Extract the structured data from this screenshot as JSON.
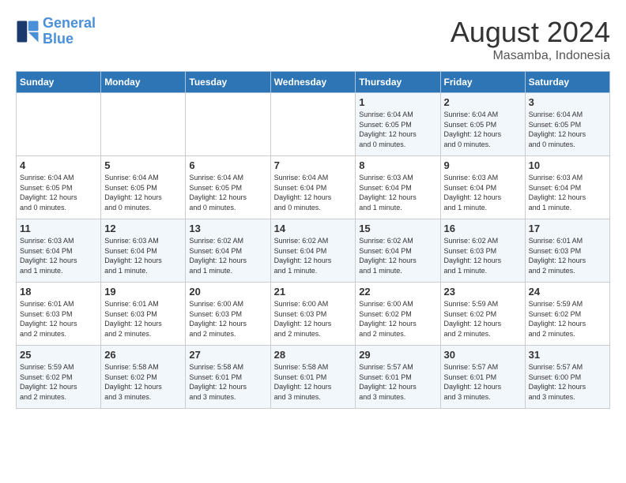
{
  "header": {
    "logo_line1": "General",
    "logo_line2": "Blue",
    "month_year": "August 2024",
    "location": "Masamba, Indonesia"
  },
  "days_of_week": [
    "Sunday",
    "Monday",
    "Tuesday",
    "Wednesday",
    "Thursday",
    "Friday",
    "Saturday"
  ],
  "weeks": [
    [
      {
        "day": "",
        "info": ""
      },
      {
        "day": "",
        "info": ""
      },
      {
        "day": "",
        "info": ""
      },
      {
        "day": "",
        "info": ""
      },
      {
        "day": "1",
        "info": "Sunrise: 6:04 AM\nSunset: 6:05 PM\nDaylight: 12 hours\nand 0 minutes."
      },
      {
        "day": "2",
        "info": "Sunrise: 6:04 AM\nSunset: 6:05 PM\nDaylight: 12 hours\nand 0 minutes."
      },
      {
        "day": "3",
        "info": "Sunrise: 6:04 AM\nSunset: 6:05 PM\nDaylight: 12 hours\nand 0 minutes."
      }
    ],
    [
      {
        "day": "4",
        "info": "Sunrise: 6:04 AM\nSunset: 6:05 PM\nDaylight: 12 hours\nand 0 minutes."
      },
      {
        "day": "5",
        "info": "Sunrise: 6:04 AM\nSunset: 6:05 PM\nDaylight: 12 hours\nand 0 minutes."
      },
      {
        "day": "6",
        "info": "Sunrise: 6:04 AM\nSunset: 6:05 PM\nDaylight: 12 hours\nand 0 minutes."
      },
      {
        "day": "7",
        "info": "Sunrise: 6:04 AM\nSunset: 6:04 PM\nDaylight: 12 hours\nand 0 minutes."
      },
      {
        "day": "8",
        "info": "Sunrise: 6:03 AM\nSunset: 6:04 PM\nDaylight: 12 hours\nand 1 minute."
      },
      {
        "day": "9",
        "info": "Sunrise: 6:03 AM\nSunset: 6:04 PM\nDaylight: 12 hours\nand 1 minute."
      },
      {
        "day": "10",
        "info": "Sunrise: 6:03 AM\nSunset: 6:04 PM\nDaylight: 12 hours\nand 1 minute."
      }
    ],
    [
      {
        "day": "11",
        "info": "Sunrise: 6:03 AM\nSunset: 6:04 PM\nDaylight: 12 hours\nand 1 minute."
      },
      {
        "day": "12",
        "info": "Sunrise: 6:03 AM\nSunset: 6:04 PM\nDaylight: 12 hours\nand 1 minute."
      },
      {
        "day": "13",
        "info": "Sunrise: 6:02 AM\nSunset: 6:04 PM\nDaylight: 12 hours\nand 1 minute."
      },
      {
        "day": "14",
        "info": "Sunrise: 6:02 AM\nSunset: 6:04 PM\nDaylight: 12 hours\nand 1 minute."
      },
      {
        "day": "15",
        "info": "Sunrise: 6:02 AM\nSunset: 6:04 PM\nDaylight: 12 hours\nand 1 minute."
      },
      {
        "day": "16",
        "info": "Sunrise: 6:02 AM\nSunset: 6:03 PM\nDaylight: 12 hours\nand 1 minute."
      },
      {
        "day": "17",
        "info": "Sunrise: 6:01 AM\nSunset: 6:03 PM\nDaylight: 12 hours\nand 2 minutes."
      }
    ],
    [
      {
        "day": "18",
        "info": "Sunrise: 6:01 AM\nSunset: 6:03 PM\nDaylight: 12 hours\nand 2 minutes."
      },
      {
        "day": "19",
        "info": "Sunrise: 6:01 AM\nSunset: 6:03 PM\nDaylight: 12 hours\nand 2 minutes."
      },
      {
        "day": "20",
        "info": "Sunrise: 6:00 AM\nSunset: 6:03 PM\nDaylight: 12 hours\nand 2 minutes."
      },
      {
        "day": "21",
        "info": "Sunrise: 6:00 AM\nSunset: 6:03 PM\nDaylight: 12 hours\nand 2 minutes."
      },
      {
        "day": "22",
        "info": "Sunrise: 6:00 AM\nSunset: 6:02 PM\nDaylight: 12 hours\nand 2 minutes."
      },
      {
        "day": "23",
        "info": "Sunrise: 5:59 AM\nSunset: 6:02 PM\nDaylight: 12 hours\nand 2 minutes."
      },
      {
        "day": "24",
        "info": "Sunrise: 5:59 AM\nSunset: 6:02 PM\nDaylight: 12 hours\nand 2 minutes."
      }
    ],
    [
      {
        "day": "25",
        "info": "Sunrise: 5:59 AM\nSunset: 6:02 PM\nDaylight: 12 hours\nand 2 minutes."
      },
      {
        "day": "26",
        "info": "Sunrise: 5:58 AM\nSunset: 6:02 PM\nDaylight: 12 hours\nand 3 minutes."
      },
      {
        "day": "27",
        "info": "Sunrise: 5:58 AM\nSunset: 6:01 PM\nDaylight: 12 hours\nand 3 minutes."
      },
      {
        "day": "28",
        "info": "Sunrise: 5:58 AM\nSunset: 6:01 PM\nDaylight: 12 hours\nand 3 minutes."
      },
      {
        "day": "29",
        "info": "Sunrise: 5:57 AM\nSunset: 6:01 PM\nDaylight: 12 hours\nand 3 minutes."
      },
      {
        "day": "30",
        "info": "Sunrise: 5:57 AM\nSunset: 6:01 PM\nDaylight: 12 hours\nand 3 minutes."
      },
      {
        "day": "31",
        "info": "Sunrise: 5:57 AM\nSunset: 6:00 PM\nDaylight: 12 hours\nand 3 minutes."
      }
    ]
  ]
}
